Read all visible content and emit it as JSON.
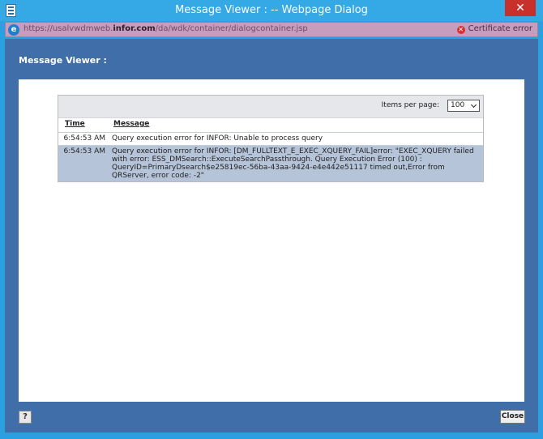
{
  "window": {
    "title": "Message Viewer :  -- Webpage Dialog",
    "close_glyph": "✕"
  },
  "address": {
    "url_prefix": "https://usalvwdmweb.",
    "url_domain": "infor.com",
    "url_suffix": "/da/wdk/container/dialogcontainer.jsp",
    "cert_label": "Certificate error"
  },
  "dialog": {
    "title": "Message Viewer :"
  },
  "grid": {
    "items_per_page_label": "Items per page:",
    "items_per_page_value": "100",
    "columns": {
      "time": "Time",
      "message": "Message"
    },
    "rows": [
      {
        "time": "6:54:53 AM",
        "message": "Query execution error for INFOR: Unable to process query"
      },
      {
        "time": "6:54:53 AM",
        "message": "Query execution error for INFOR: [DM_FULLTEXT_E_EXEC_XQUERY_FAIL]error: \"EXEC_XQUERY failed with error: ESS_DMSearch::ExecuteSearchPassthrough. Query Execution Error (100) : QueryID=PrimaryDsearch$e25819ec-56ba-43aa-9424-e4e442e51117 timed out,Error from QRServer, error code: -2\""
      }
    ]
  },
  "footer": {
    "help_label": "?",
    "close_label": "Close"
  }
}
